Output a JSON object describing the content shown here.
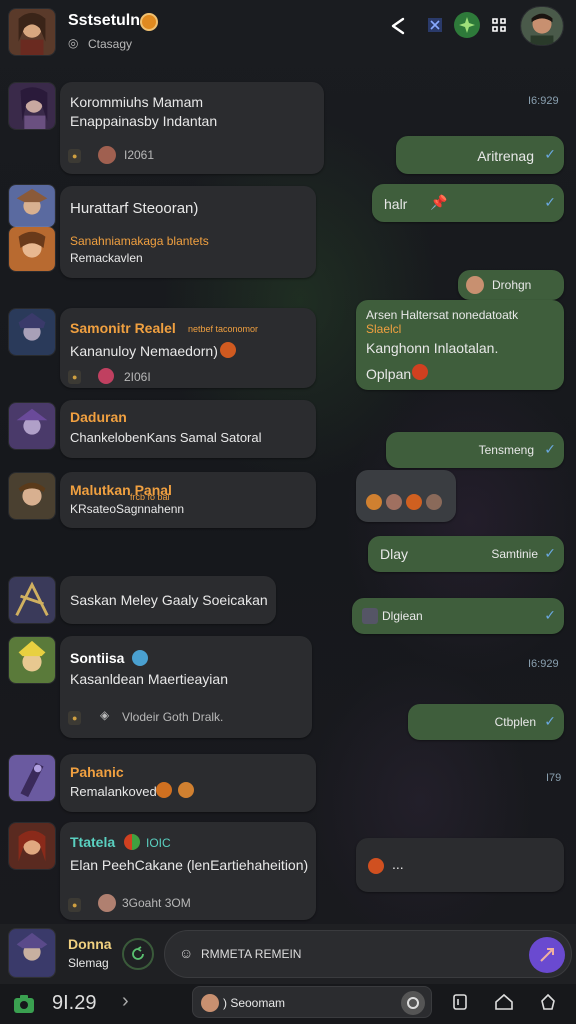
{
  "header": {
    "title": "Sstsetuln",
    "subtitle": "Ctasagy",
    "status_emoji": "ʘ"
  },
  "messages_in": [
    {
      "name": "Korommiuhs Mamam",
      "line2": "Enappainasby Indantan",
      "tag": "●",
      "meta": "I2061"
    },
    {
      "name": "Hurattarf Steooran)",
      "line2": "Sanahniamakaga blantets",
      "line3": "Remackavlen"
    },
    {
      "name": "Samonitr Realel",
      "extra": "netbef taconomor",
      "line2": "Kananuloy Nemaedorn)",
      "meta": "2I06I"
    },
    {
      "name": "Daduran",
      "line2": "ChankelobenKans Samal Satoral"
    },
    {
      "name": "Malutkan Panal",
      "extra": "frcb fo bal",
      "line2": "KRsateoSagnnahenn"
    },
    {
      "name": "Saskan Meley Gaaly Soeicakan"
    },
    {
      "name": "Sontiisa",
      "line2": "Kasanldean Maertieayian",
      "meta": "Vlodeir Goth Dralk."
    },
    {
      "name": "Pahanic",
      "line2": "Remalankoved"
    },
    {
      "name": "Ttatela",
      "extra": "IOIC",
      "line2": "Elan PeehCakane (lenEartiehaheition)",
      "meta": "3Goaht 3OM"
    }
  ],
  "messages_out": [
    {
      "text": "Aritrenag",
      "time": "I6:929"
    },
    {
      "text": "halr"
    },
    {
      "text": "Drohgn"
    },
    {
      "text": "Arsen Haltersat nonedatoatk",
      "line2": "Slaelcl",
      "line3": "Kanghonn Inlaotalan.",
      "line4": "Oplpan"
    },
    {
      "text": "Tensmeng"
    },
    {
      "text": "Dlay",
      "right": "Samtinie"
    },
    {
      "text": "Dlgiean",
      "time": "I6:929"
    },
    {
      "text": "Ctbplen"
    },
    {
      "text": "...",
      "time": "I79"
    }
  ],
  "input": {
    "status_name": "Donna",
    "status_sub": "Slemag",
    "placeholder": "RMMETA REMEIN"
  },
  "navbar": {
    "clock": "9I.29",
    "search_text": ") Seoomam"
  }
}
